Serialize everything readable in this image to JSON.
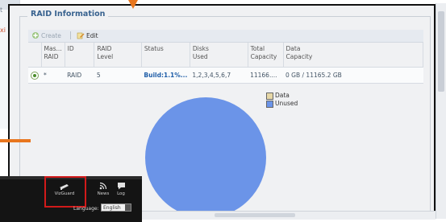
{
  "background_window": {
    "fragment_1": "t",
    "fragment_2": "xi"
  },
  "panel": {
    "legend": "RAID Information",
    "toolbar": {
      "create_label": "Create",
      "edit_label": "Edit"
    },
    "table": {
      "headers": [
        "Mas...\nRAID",
        "ID",
        "RAID\nLevel",
        "Status",
        "Disks\nUsed",
        "Total\nCapacity",
        "Data\nCapacity"
      ],
      "rows": [
        {
          "master": "*",
          "id": "RAID",
          "level": "5",
          "status": "Build:1.1%...",
          "disks": "1,2,3,4,5,6,7",
          "total": "11166....",
          "data_capacity": "0 GB / 11165.2 GB"
        }
      ]
    }
  },
  "chart_data": {
    "type": "pie",
    "labels": [
      "Data",
      "Unused"
    ],
    "values": [
      0,
      11165.2
    ],
    "colors": [
      "#e6d7a6",
      "#6b94e8"
    ]
  },
  "bottombar": {
    "items": [
      {
        "label": "VizGuard",
        "icon": "vizguard-icon"
      },
      {
        "label": "News",
        "icon": "rss-icon"
      },
      {
        "label": "Log",
        "icon": "chat-icon"
      }
    ],
    "language_label": "Language:",
    "language_value": "English"
  },
  "colors": {
    "legend_text": "#38628f",
    "status_text": "#1f5ea8",
    "highlight": "#d11a1a",
    "callout_arrow": "#e8761e"
  }
}
